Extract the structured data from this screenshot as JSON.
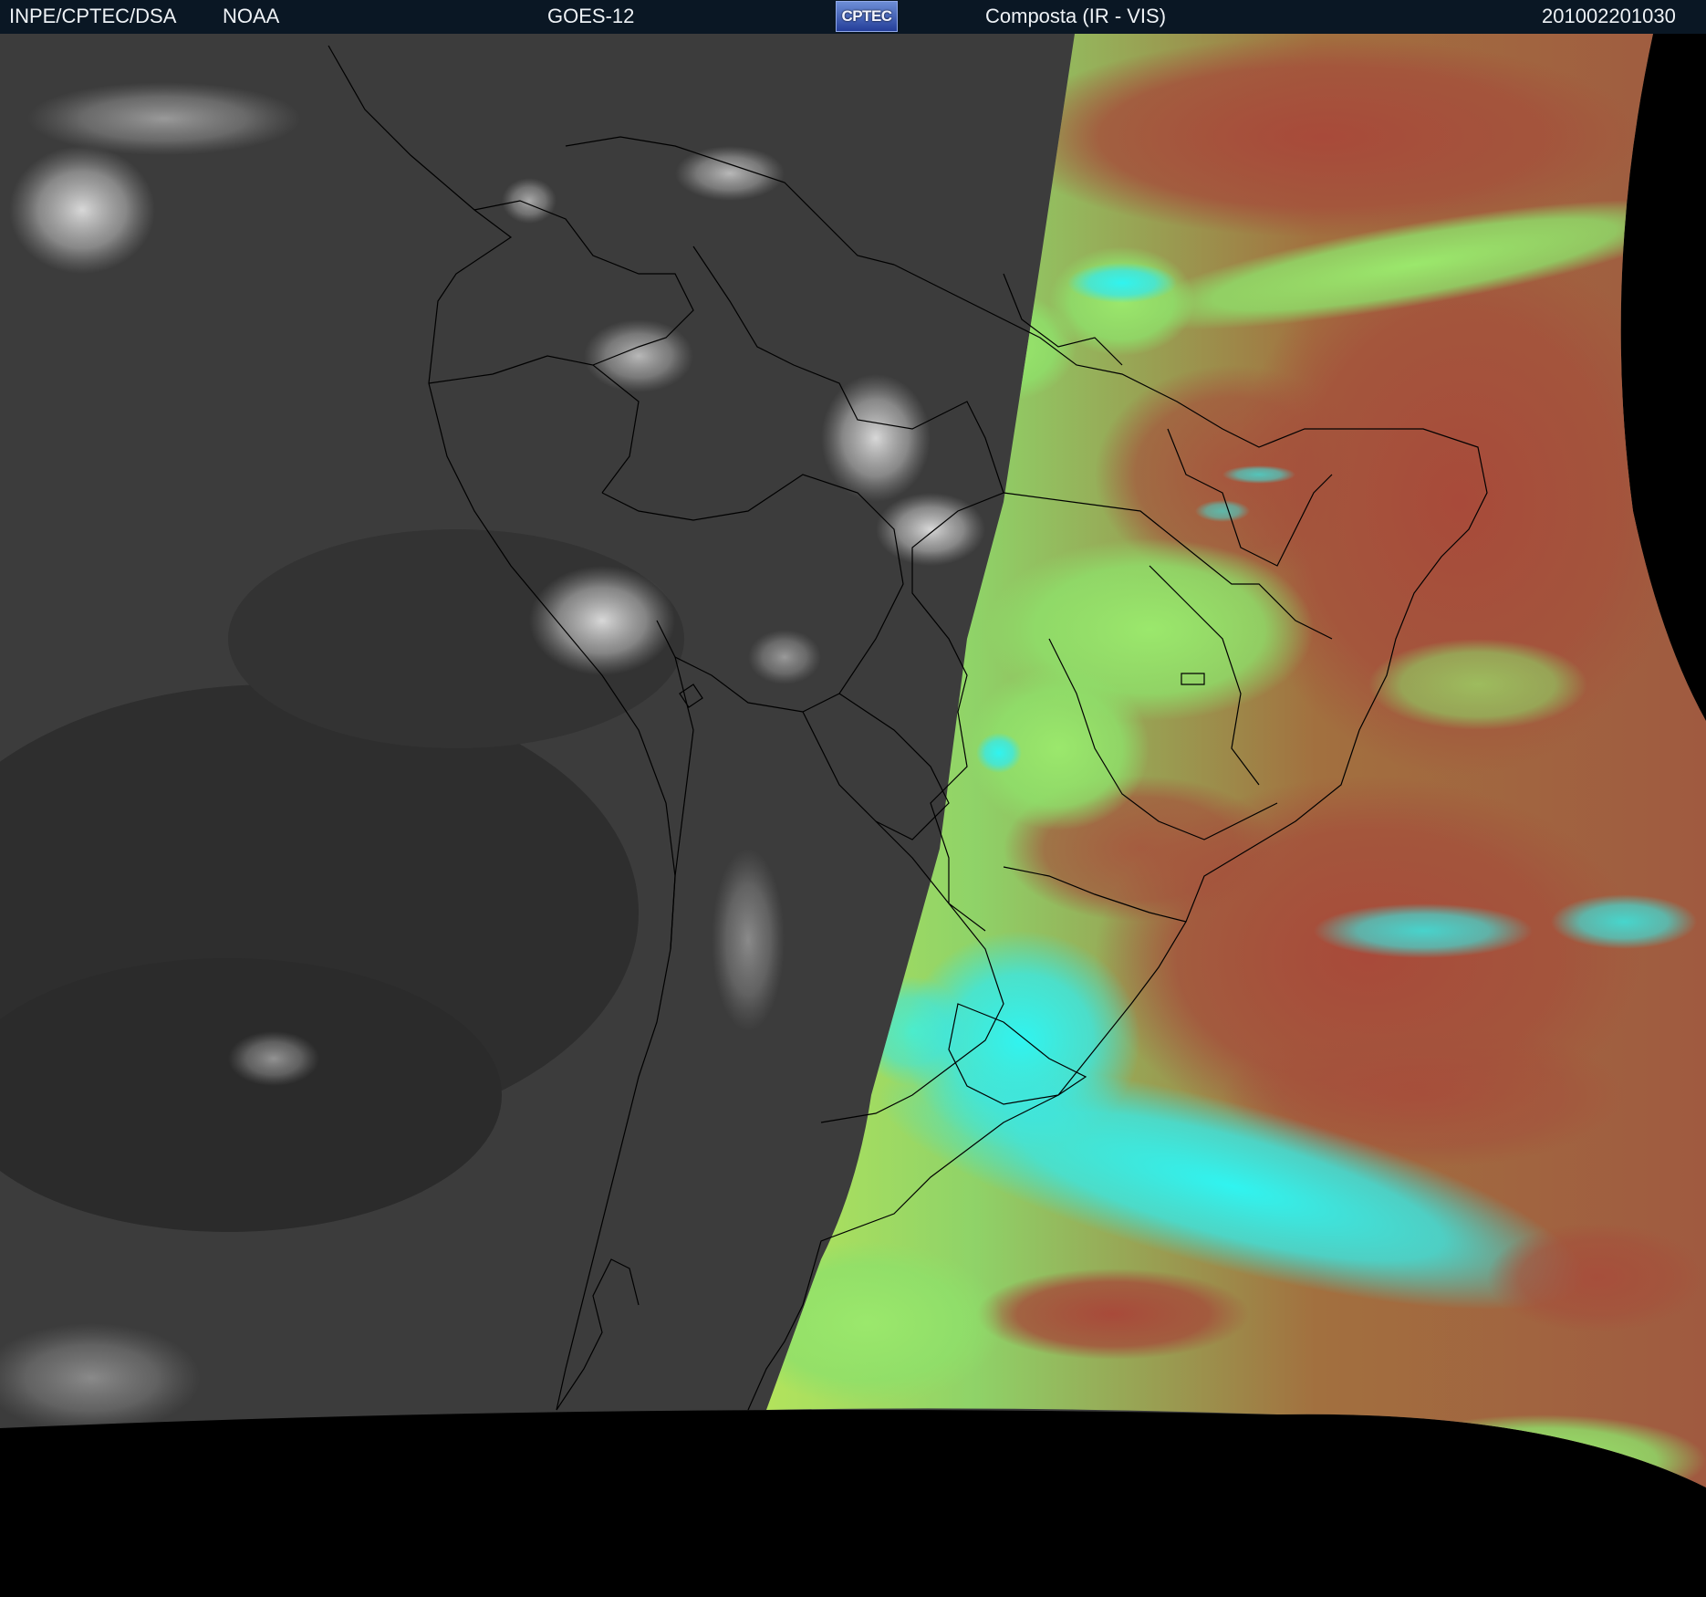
{
  "header": {
    "org": "INPE/CPTEC/DSA",
    "agency": "NOAA",
    "satellite": "GOES-12",
    "logo_text": "CPTEC",
    "product": "Composta (IR - VIS)",
    "timestamp": "201002201030"
  },
  "colors": {
    "header_bg": "#0a1724",
    "header_text": "#eef2f6",
    "ir_gray": "#3a3a3a",
    "vis_green": "#8fe36a",
    "vis_red": "#a44a3c",
    "cloud_cyan": "#2cf0ee",
    "border_line": "#000000",
    "space": "#000000"
  }
}
